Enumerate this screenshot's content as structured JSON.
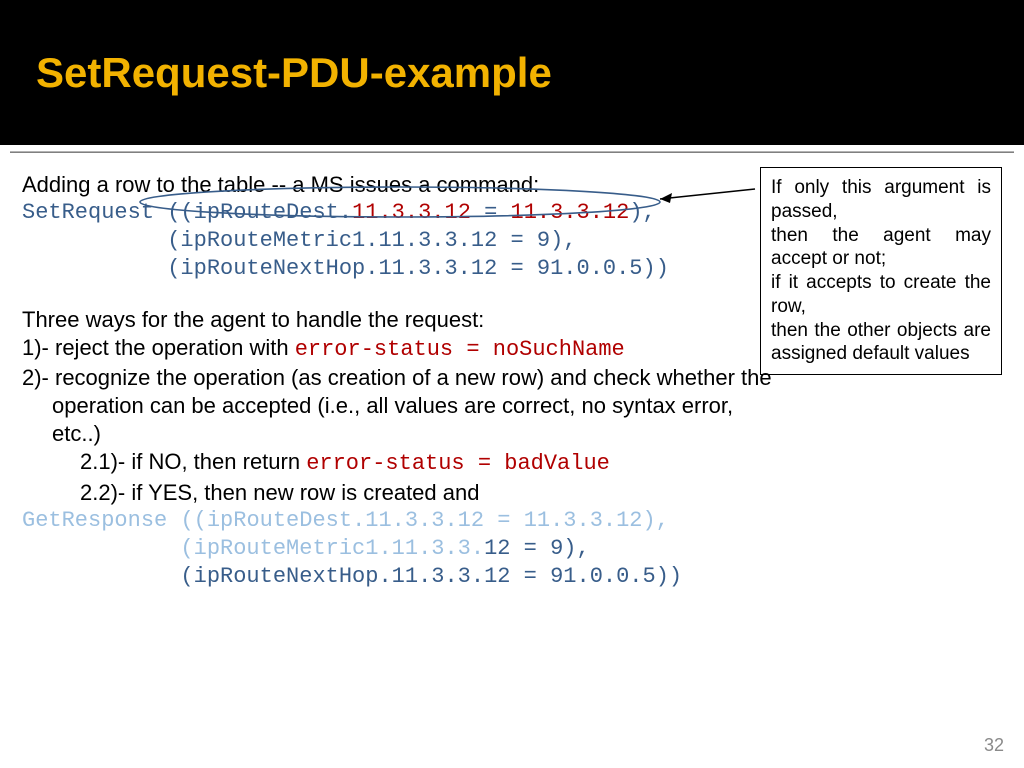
{
  "title": "SetRequest-PDU-example",
  "intro": "Adding a row to the table -- a MS issues a command:",
  "setreq": {
    "kw": "SetRequest ",
    "l1a": "((",
    "l1b": "ipRouteDest.",
    "l1c": "11.3.3.12 ",
    "l1d": "= ",
    "l1e": "11.3.3.12",
    "l1f": "),",
    "l2": "           (ipRouteMetric1.11.3.3.12 = 9),",
    "l3": "           (ipRouteNextHop.11.3.3.12 = 91.0.0.5))"
  },
  "three_ways": "Three ways for the agent to handle the request:",
  "opt1a": "1)- reject the operation with ",
  "opt1b": "error-status = noSuchName",
  "opt2": "2)- recognize the operation (as creation of a new row) and check whether the operation can be accepted (i.e., all values are correct, no syntax error, etc..)",
  "opt21a": "2.1)- if NO, then return ",
  "opt21b": "error-status = badValue",
  "opt22": "2.2)- if YES, then new row is created and",
  "getresp": {
    "kw": "GetResponse ",
    "l1": "((ipRouteDest.11.3.3.12 = 11.3.3.12),",
    "l2a": "            (ipRouteMetric1.11.3.3.",
    "l2b": "12 = 9),",
    "l3": "            (ipRouteNextHop.11.3.3.12 = 91.0.0.5))"
  },
  "callout": "If only this argument is passed,\nthen the agent may accept or not;\nif it accepts to create the row,\nthen the other objects are assigned default values",
  "page": "32"
}
